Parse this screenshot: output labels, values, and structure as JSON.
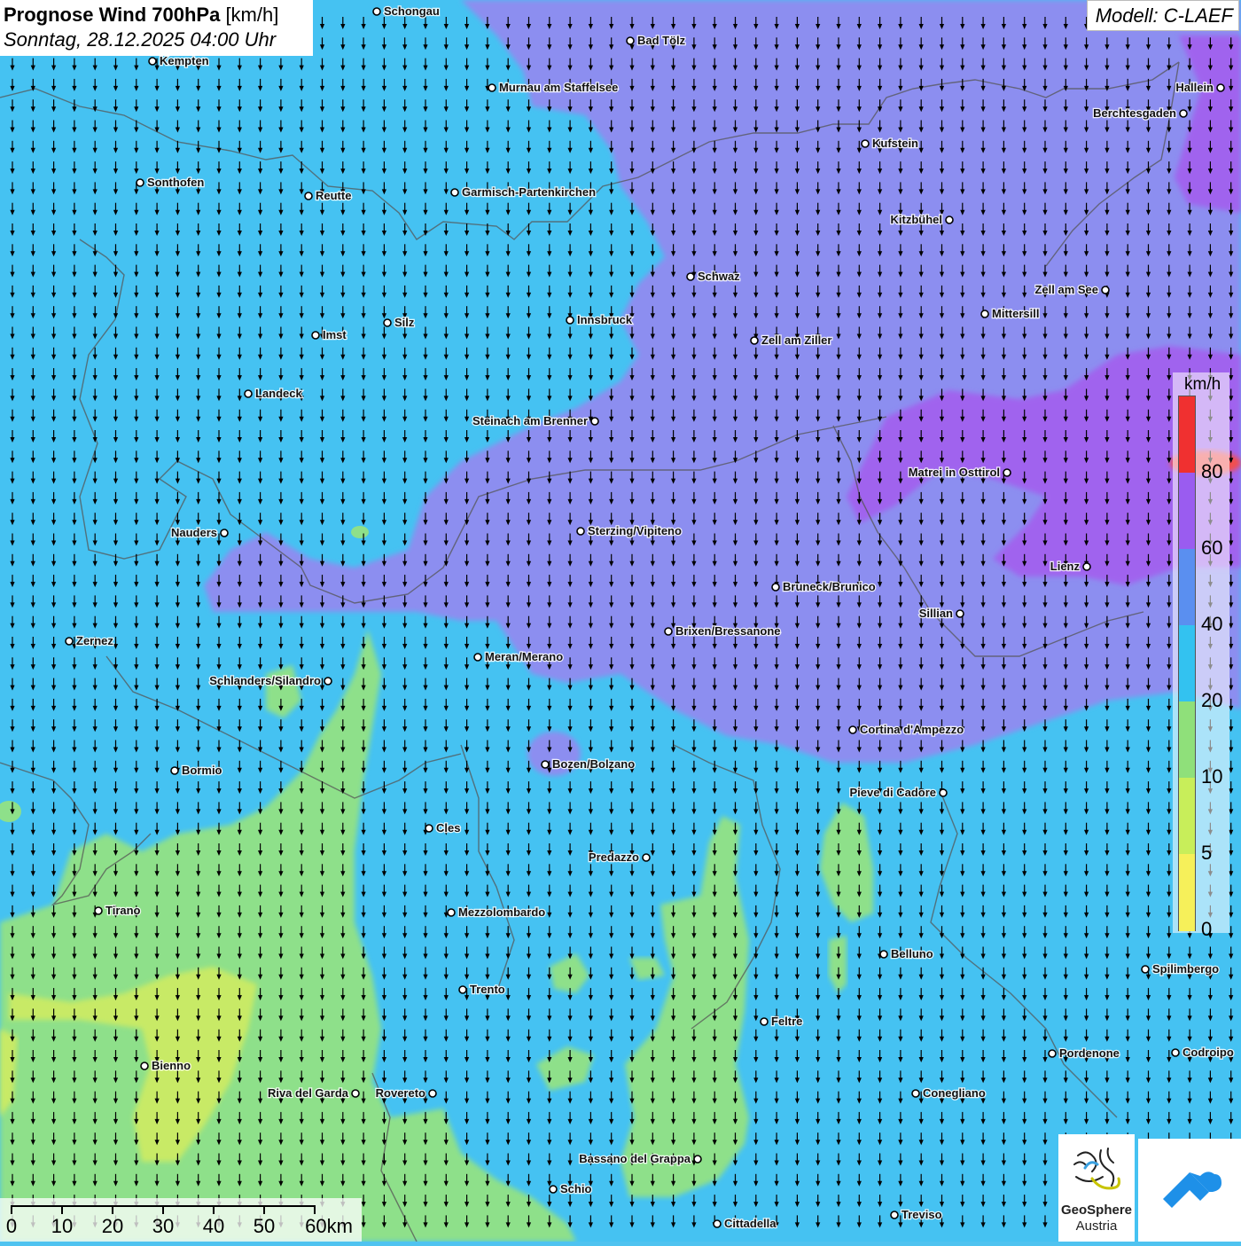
{
  "title": {
    "main": "Prognose Wind 700hPa",
    "unit": "[km/h]",
    "datetime": "Sonntag, 28.12.2025 04:00 Uhr"
  },
  "model_label": "Modell: C-LAEF",
  "legend": {
    "unit": "km/h",
    "ticks": [
      "80",
      "60",
      "40",
      "20",
      "10",
      "5",
      "0"
    ],
    "colors": [
      "#f03030",
      "#9a5cf0",
      "#5a8ff0",
      "#33c2f0",
      "#8fe07a",
      "#c8ee5a",
      "#f6f05a"
    ]
  },
  "scale_bar": {
    "labels": [
      "0",
      "10",
      "20",
      "30",
      "40",
      "50",
      "60km"
    ]
  },
  "logos": {
    "geosphere_line1": "GeoSphere",
    "geosphere_line2": "Austria"
  },
  "field_colors": {
    "light_blue_20_40": "#45c2f2",
    "blue_purple_40_60": "#8c8ef0",
    "purple_60_80": "#a064ee",
    "green_10_20": "#8ee08a",
    "yellow_green_5_10": "#c8ea66",
    "wind_arrow": "#000000"
  },
  "wind_direction": "from north (arrows pointing south)",
  "cities": [
    {
      "name": "Schongau"
    },
    {
      "name": "Bad Tölz"
    },
    {
      "name": "Kempten"
    },
    {
      "name": "Murnau am Staffelsee"
    },
    {
      "name": "Hallein"
    },
    {
      "name": "Berchtesgaden"
    },
    {
      "name": "Kufstein"
    },
    {
      "name": "Sonthofen"
    },
    {
      "name": "Reutte"
    },
    {
      "name": "Garmisch-Partenkirchen"
    },
    {
      "name": "Kitzbühel"
    },
    {
      "name": "Schwaz"
    },
    {
      "name": "Zell am See"
    },
    {
      "name": "Innsbruck"
    },
    {
      "name": "Mittersill"
    },
    {
      "name": "Silz"
    },
    {
      "name": "Imst"
    },
    {
      "name": "Zell am Ziller"
    },
    {
      "name": "Landeck"
    },
    {
      "name": "Steinach am Brenner"
    },
    {
      "name": "Matrei in Osttirol"
    },
    {
      "name": "Nauders"
    },
    {
      "name": "Sterzing/Vipiteno"
    },
    {
      "name": "Lienz"
    },
    {
      "name": "Bruneck/Brunico"
    },
    {
      "name": "Sillian"
    },
    {
      "name": "Zernez"
    },
    {
      "name": "Brixen/Bressanone"
    },
    {
      "name": "Meran/Merano"
    },
    {
      "name": "Schlanders/Silandro"
    },
    {
      "name": "Cortina d'Ampezzo"
    },
    {
      "name": "Bozen/Bolzano"
    },
    {
      "name": "Bormio"
    },
    {
      "name": "Pieve di Cadore"
    },
    {
      "name": "Cles"
    },
    {
      "name": "Predazzo"
    },
    {
      "name": "Tirano"
    },
    {
      "name": "Mezzolombardo"
    },
    {
      "name": "Belluno"
    },
    {
      "name": "Spilimbergo"
    },
    {
      "name": "Trento"
    },
    {
      "name": "Feltre"
    },
    {
      "name": "Pordenone"
    },
    {
      "name": "Codroipo"
    },
    {
      "name": "Bienno"
    },
    {
      "name": "Riva del Garda"
    },
    {
      "name": "Rovereto"
    },
    {
      "name": "Conegliano"
    },
    {
      "name": "Bassano del Grappa"
    },
    {
      "name": "Schio"
    },
    {
      "name": "Treviso"
    },
    {
      "name": "Cittadella"
    }
  ]
}
